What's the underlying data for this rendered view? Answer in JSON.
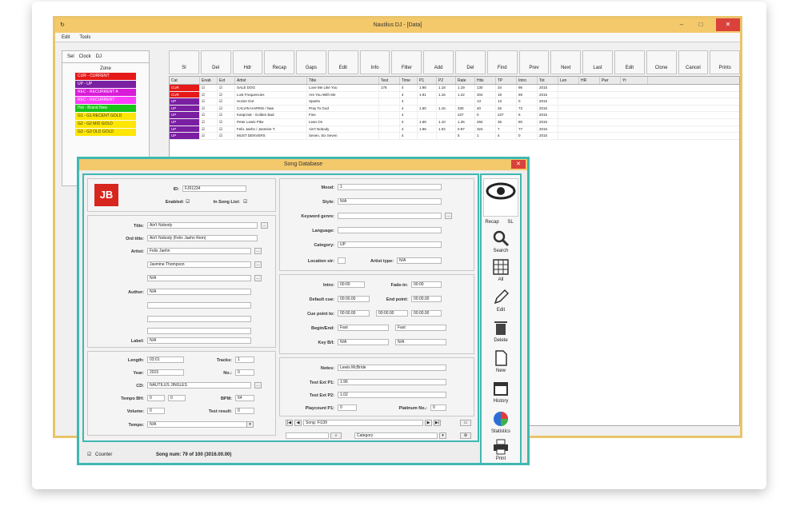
{
  "main": {
    "title": "Nautilus DJ - [Data]",
    "menu": [
      "Edit",
      "Tools"
    ],
    "left_tabs": [
      "Sel",
      "Clock",
      "DJ"
    ],
    "zone_header": "Zone",
    "zones": [
      {
        "label": "CUR - CURRENT",
        "color": "#e61919"
      },
      {
        "label": "UP - UP",
        "color": "#7a1fa2"
      },
      {
        "label": "REC - RECURRENT A",
        "color": "#d81bd8"
      },
      {
        "label": "REC - RECURRENT",
        "color": "#ff3dff"
      },
      {
        "label": "Hot - Brand New",
        "color": "#17c417"
      },
      {
        "label": "G1 - G1 RECENT GOLD",
        "color": "#ffe600"
      },
      {
        "label": "G2 - G2 MID GOLD",
        "color": "#ffe600"
      },
      {
        "label": "G3 - G3 OLD GOLD",
        "color": "#ffe600"
      }
    ],
    "toolbar": [
      "Sl",
      "Del",
      "Hdr",
      "Recap",
      "Gaps",
      "Edit",
      "Info",
      "Filter",
      "Add",
      "Del",
      "Find",
      "Prev",
      "Next",
      "Last",
      "Edit",
      "Clone",
      "Cancel",
      "Prints"
    ],
    "grid_headers": [
      "Cat",
      "Enab",
      "Ext",
      "Artist",
      "Title",
      "Test",
      "Time",
      "P1",
      "P2",
      "Rate",
      "Hits",
      "TP",
      "Intro",
      "Tot",
      "Len",
      "HR",
      "Pwr",
      "Yr"
    ],
    "grid_rows": [
      [
        "CUR",
        "☑",
        "☑",
        "SALE DOG",
        "Love Me Like You",
        "176",
        "4",
        "1.98",
        "1.18",
        "1.19",
        "130",
        "34",
        "96",
        "2015"
      ],
      [
        "CUR",
        "☑",
        "☑",
        "Lost Frequencies",
        "Are You With Me",
        "",
        "4",
        "1.91",
        "1.16",
        "1.22",
        "304",
        "18",
        "69",
        "2015"
      ],
      [
        "UP",
        "☑",
        "☑",
        "Hozier Dot",
        "Sparks",
        "",
        "4",
        "",
        "",
        "",
        "13",
        "13",
        "0",
        "2015"
      ],
      [
        "UP",
        "☑",
        "☑",
        "CALVIN HARRIS / Nae",
        "Pray To God",
        "",
        "4",
        "1.60",
        "1.16",
        "330",
        "40",
        "26",
        "73",
        "2015"
      ],
      [
        "UP",
        "☑",
        "☑",
        "Kasprzak - Golden Bad",
        "Fine",
        "",
        "4",
        "",
        "",
        "237",
        "0",
        "237",
        "6",
        "2015"
      ],
      [
        "UP",
        "☑",
        "☑",
        "Peter Lewis Pike",
        "Lean On",
        "",
        "4",
        "1.68",
        "1.10",
        "1.26",
        "284",
        "36",
        "80",
        "2015"
      ],
      [
        "UP",
        "☑",
        "☑",
        "Felix Jaehn / Jasmine T.",
        "Ain't Nobody",
        "",
        "4",
        "1.96",
        "1.02",
        "0.97",
        "324",
        "7",
        "77",
        "2015"
      ],
      [
        "UP",
        "☑",
        "☑",
        "MUST DENVERS",
        "Seven, Six Seven",
        "",
        "4",
        "",
        "",
        "5",
        "1",
        "4",
        "0",
        "2015"
      ]
    ]
  },
  "dialog": {
    "title": "Song Database",
    "logo_text": "JB",
    "id": {
      "label": "ID:",
      "value": "FJ01234"
    },
    "enabled": {
      "label": "Enabled:",
      "value": "☑"
    },
    "in_song_list": {
      "label": "In Song List:",
      "value": "☑"
    },
    "title_field": {
      "label": "Title:",
      "value": "Ain't Nobody"
    },
    "ord_title": {
      "label": "Ord title:",
      "value": "Ain't Nobody (Felix Jaehn Rem)"
    },
    "artist": {
      "label": "Artist:",
      "values": [
        "Felix Jaehn",
        "Jasmine Thompson",
        "N/A"
      ]
    },
    "author": {
      "label": "Author:",
      "values": [
        "N/A",
        "",
        "",
        ""
      ]
    },
    "label_field": {
      "label": "Label:",
      "value": "N/A"
    },
    "length": {
      "label": "Length:",
      "value": "03:01"
    },
    "tracks": {
      "label": "Tracks:",
      "value": "1"
    },
    "year": {
      "label": "Year:",
      "value": "2015"
    },
    "no": {
      "label": "No.:",
      "value": "0"
    },
    "cd": {
      "label": "CD:",
      "value": "NAUTILUS JINGLES"
    },
    "tempo_bh": {
      "label": "Tempo BH:",
      "value1": "0",
      "value2": "0"
    },
    "bpm": {
      "label": "BPM:",
      "value": "64"
    },
    "volume": {
      "label": "Volume:",
      "value": "0"
    },
    "test_result": {
      "label": "Test result:",
      "value": "0"
    },
    "tempo": {
      "label": "Tempo:",
      "value": "N/A"
    },
    "mood": {
      "label": "Mood:",
      "value": "1"
    },
    "style": {
      "label": "Style:",
      "value": "N/A"
    },
    "keyword_genre": {
      "label": "Keyword genre:",
      "value": ""
    },
    "language": {
      "label": "Language:",
      "value": ""
    },
    "category": {
      "label": "Category:",
      "value": "UP"
    },
    "location_str": {
      "label": "Location str:",
      "value": ""
    },
    "artist_type": {
      "label": "Artist type:",
      "value": "N/A"
    },
    "intro": {
      "label": "Intro:",
      "value": "00:00"
    },
    "fade_in": {
      "label": "Fade-in:",
      "value": "00:00"
    },
    "default_cue": {
      "label": "Default cue:",
      "value": "00:00.00"
    },
    "end_point": {
      "label": "End point:",
      "value": "00:00.00"
    },
    "cue_point": {
      "label": "Cue point to:",
      "value": "00:00.00",
      "value2": "00:00.00",
      "value3": "00:00.00"
    },
    "begin_end": {
      "label": "Begin/End:",
      "value1": "Fast",
      "value2": "Fast"
    },
    "key_bi": {
      "label": "Key B/I:",
      "value1": "N/A",
      "value2": "N/A"
    },
    "notes": {
      "label": "Notes:",
      "value": "Lewis McBride"
    },
    "test_ext_p1": {
      "label": "Test Ext P1:",
      "value": "1.96"
    },
    "test_ext_p2": {
      "label": "Test Ext P2:",
      "value": "1.02"
    },
    "playcount": {
      "label": "Playcount P1:",
      "value": "0"
    },
    "platinum": {
      "label": "Platinum No.:",
      "value": "0"
    },
    "nav_value": "Song: Fi139",
    "counter": {
      "label": "Counter",
      "value": "☑"
    },
    "status": "Song num: 79 of 100 (3016.00.00)",
    "category_select": "Category",
    "sidebar": [
      {
        "label": "Recap",
        "icon": "eye-icon"
      },
      {
        "label": "Search",
        "icon": "magnifier-icon"
      },
      {
        "label": "All",
        "icon": "grid-icon"
      },
      {
        "label": "Edit",
        "icon": "pencil-icon"
      },
      {
        "label": "Delete",
        "icon": "trash-icon"
      },
      {
        "label": "New",
        "icon": "document-icon"
      },
      {
        "label": "History",
        "icon": "calendar-icon"
      },
      {
        "label": "Statistics",
        "icon": "pie-chart-icon"
      },
      {
        "label": "Print",
        "icon": "printer-icon"
      }
    ],
    "recap_extra": "SL"
  }
}
